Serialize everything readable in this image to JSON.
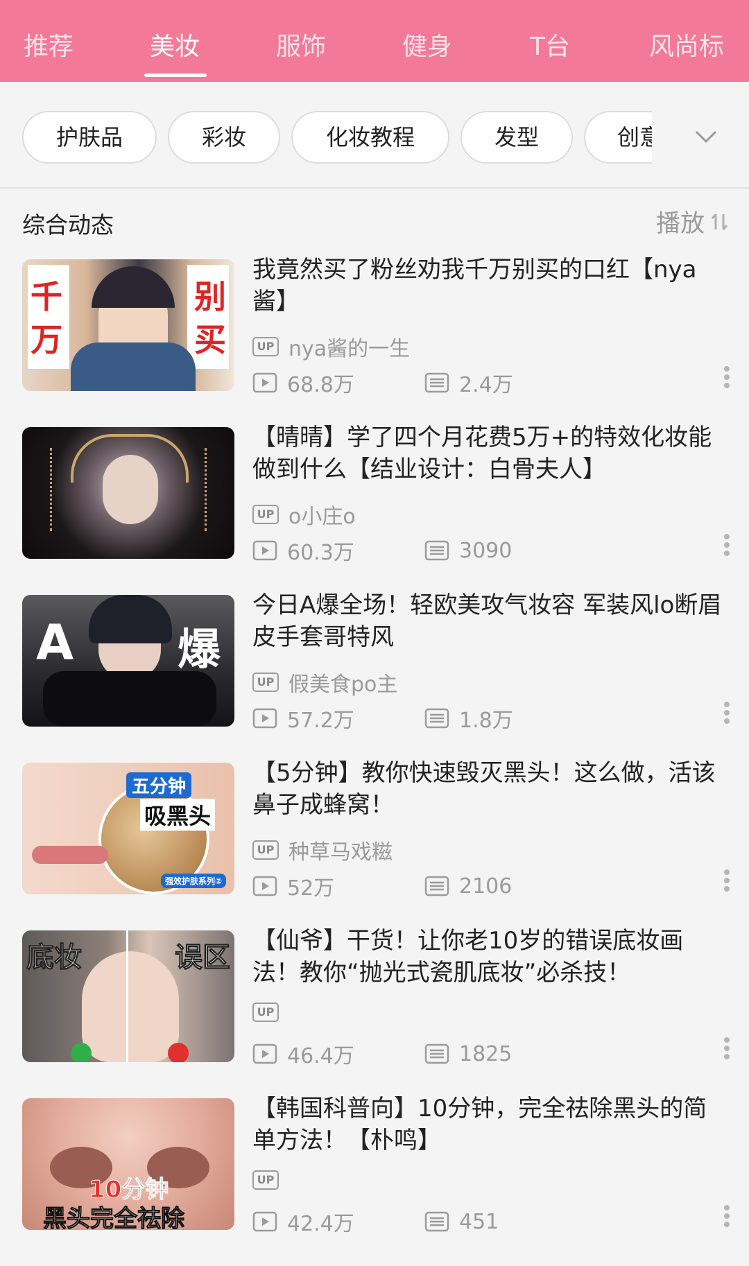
{
  "tabs": [
    {
      "label": "推荐",
      "active": false
    },
    {
      "label": "美妆",
      "active": true
    },
    {
      "label": "服饰",
      "active": false
    },
    {
      "label": "健身",
      "active": false
    },
    {
      "label": "T台",
      "active": false
    },
    {
      "label": "风尚标",
      "active": false
    }
  ],
  "chips": [
    "护肤品",
    "彩妆",
    "化妆教程",
    "发型",
    "创意"
  ],
  "section": {
    "title": "综合动态",
    "sort_label": "播放"
  },
  "up_badge": "UP",
  "videos": [
    {
      "title": "我竟然买了粉丝劝我千万别买的口红【nya酱】",
      "uploader": "nya酱的一生",
      "plays": "68.8万",
      "comments": "2.4万",
      "thumb_text": [
        "千",
        "万",
        "别",
        "买"
      ]
    },
    {
      "title": "【晴晴】学了四个月花费5万+的特效化妆能做到什么【结业设计：白骨夫人】",
      "uploader": "o小庄o",
      "plays": "60.3万",
      "comments": "3090",
      "thumb_text": []
    },
    {
      "title": "今日A爆全场！轻欧美攻气妆容  军装风lo断眉皮手套哥特风",
      "uploader": "假美食po主",
      "plays": "57.2万",
      "comments": "1.8万",
      "thumb_text": [
        "A",
        "爆"
      ]
    },
    {
      "title": "【5分钟】教你快速毁灭黑头！这么做，活该鼻子成蜂窝！",
      "uploader": "种草马戏糍",
      "plays": "52万",
      "comments": "2106",
      "thumb_text": [
        "五分钟",
        "吸黑头",
        "强效护肤系列②"
      ]
    },
    {
      "title": "【仙爷】干货！让你老10岁的错误底妆画法！教你“抛光式瓷肌底妆”必杀技！",
      "uploader": "",
      "plays": "46.4万",
      "comments": "1825",
      "thumb_text": [
        "底妆",
        "误区"
      ]
    },
    {
      "title": "【韩国科普向】10分钟，完全祛除黑头的简单方法！【朴鸣】",
      "uploader": "",
      "plays": "42.4万",
      "comments": "451",
      "thumb_text": [
        "10分钟",
        "黑头完全祛除"
      ]
    }
  ],
  "colors": {
    "header_bg": "#f27a98",
    "meta_gray": "#9a9a9a"
  }
}
